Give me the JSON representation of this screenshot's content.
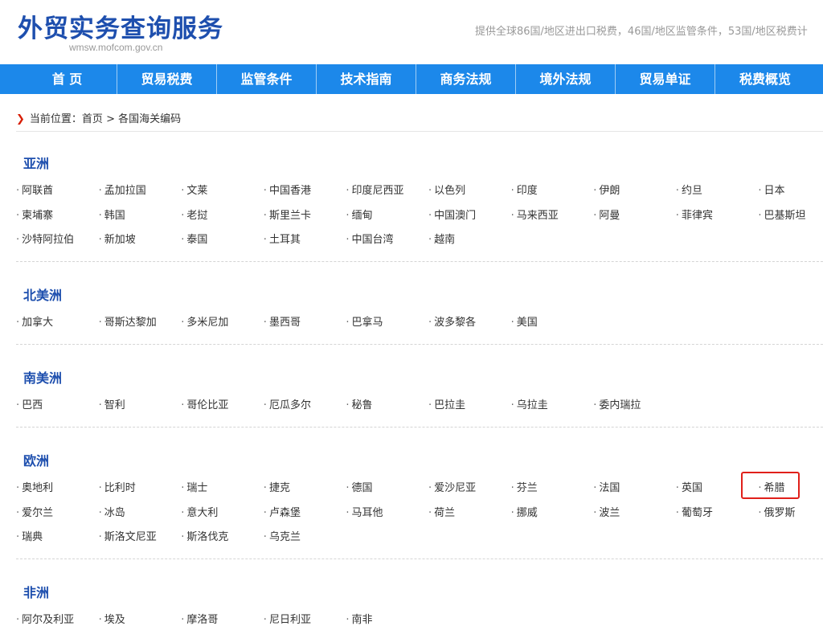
{
  "header": {
    "title": "外贸实务查询服务",
    "url": "wmsw.mofcom.gov.cn",
    "tagline": "提供全球86国/地区进出口税费，46国/地区监管条件，53国/地区税费计"
  },
  "nav": [
    "首 页",
    "贸易税费",
    "监管条件",
    "技术指南",
    "商务法规",
    "境外法规",
    "贸易单证",
    "税费概览"
  ],
  "breadcrumb": {
    "label": "当前位置：",
    "home": "首页",
    "separator": " > ",
    "current": "各国海关编码"
  },
  "regions": [
    {
      "title": "亚洲",
      "countries": [
        "阿联酋",
        "孟加拉国",
        "文莱",
        "中国香港",
        "印度尼西亚",
        "以色列",
        "印度",
        "伊朗",
        "约旦",
        "日本",
        "柬埔寨",
        "韩国",
        "老挝",
        "斯里兰卡",
        "缅甸",
        "中国澳门",
        "马来西亚",
        "阿曼",
        "菲律宾",
        "巴基斯坦",
        "沙特阿拉伯",
        "新加坡",
        "泰国",
        "土耳其",
        "中国台湾",
        "越南"
      ]
    },
    {
      "title": "北美洲",
      "countries": [
        "加拿大",
        "哥斯达黎加",
        "多米尼加",
        "墨西哥",
        "巴拿马",
        "波多黎各",
        "美国"
      ]
    },
    {
      "title": "南美洲",
      "countries": [
        "巴西",
        "智利",
        "哥伦比亚",
        "厄瓜多尔",
        "秘鲁",
        "巴拉圭",
        "乌拉圭",
        "委内瑞拉"
      ]
    },
    {
      "title": "欧洲",
      "countries": [
        "奥地利",
        "比利时",
        "瑞士",
        "捷克",
        "德国",
        "爱沙尼亚",
        "芬兰",
        "法国",
        "英国",
        "希腊",
        "爱尔兰",
        "冰岛",
        "意大利",
        "卢森堡",
        "马耳他",
        "荷兰",
        "挪威",
        "波兰",
        "葡萄牙",
        "俄罗斯",
        "瑞典",
        "斯洛文尼亚",
        "斯洛伐克",
        "乌克兰"
      ]
    },
    {
      "title": "非洲",
      "countries": [
        "阿尔及利亚",
        "埃及",
        "摩洛哥",
        "尼日利亚",
        "南非"
      ]
    }
  ],
  "highlighted_country": "希腊",
  "colors": {
    "nav_bg": "#1c88ea",
    "title_blue": "#1e4fae",
    "highlight_red": "#e0201a"
  }
}
